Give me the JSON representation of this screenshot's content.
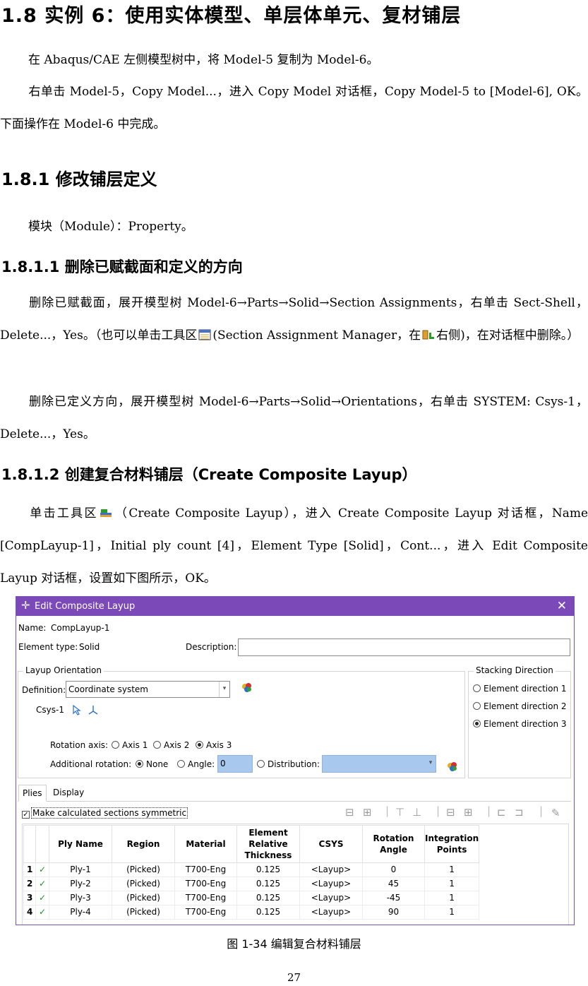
{
  "heading_1_8": "1.8 实例 6：使用实体模型、单层体单元、复材铺层",
  "p1": "在 Abaqus/CAE 左侧模型树中，将 Model-5 复制为 Model-6。",
  "p2": "右单击 Model-5，Copy Model...，进入 Copy Model 对话框，Copy Model-5 to [Model-6], OK。下面操作在 Model-6 中完成。",
  "heading_1_8_1": "1.8.1 修改铺层定义",
  "p3": "模块（Module）：Property。",
  "heading_1_8_1_1": "1.8.1.1 删除已赋截面和定义的方向",
  "p4a": "删除已赋截面，展开模型树 Model-6→Parts→Solid→Section Assignments，右单击 Sect-Shell，Delete...，Yes。（也可以单击工具区",
  "p4b": "(Section Assignment Manager，在",
  "p4c": "右侧)，在对话框中删除。）",
  "p5": "删除已定义方向，展开模型树 Model-6→Parts→Solid→Orientations，右单击 SYSTEM: Csys-1，Delete...，Yes。",
  "heading_1_8_1_2": "1.8.1.2 创建复合材料铺层（Create Composite Layup）",
  "p6a": "单击工具区",
  "p6b": "（Create Composite Layup），进入 Create Composite Layup 对话框，Name [CompLayup-1]，Initial ply count [4]，Element Type [Solid]，Cont...，进入 Edit Composite Layup 对话框，设置如下图所示，OK。",
  "dialog": {
    "title": "Edit Composite Layup",
    "name_label": "Name:",
    "name_value": "CompLayup-1",
    "element_type_label": "Element type:",
    "element_type_value": "Solid",
    "description_label": "Description:",
    "description_value": "",
    "layup_orientation_title": "Layup Orientation",
    "definition_label": "Definition:",
    "definition_value": "Coordinate system",
    "csys_value": "Csys-1",
    "rotation_axis_label": "Rotation axis:",
    "axis_options": [
      "Axis 1",
      "Axis 2",
      "Axis 3"
    ],
    "axis_selected": "Axis 3",
    "additional_rotation_label": "Additional rotation:",
    "none_label": "None",
    "angle_label": "Angle:",
    "angle_value": "0",
    "distribution_label": "Distribution:",
    "stacking_title": "Stacking Direction",
    "stacking_options": [
      "Element direction 1",
      "Element direction 2",
      "Element direction 3"
    ],
    "stacking_selected": "Element direction 3",
    "tabs": [
      "Plies",
      "Display"
    ],
    "active_tab": "Plies",
    "symmetric_label": "Make calculated sections symmetric",
    "columns": [
      "Ply Name",
      "Region",
      "Material",
      "Element Relative Thickness",
      "CSYS",
      "Rotation Angle",
      "Integration Points"
    ],
    "rows": [
      {
        "num": "1",
        "ply": "Ply-1",
        "region": "(Picked)",
        "material": "T700-Eng",
        "thickness": "0.125",
        "csys": "<Layup>",
        "angle": "0",
        "points": "1"
      },
      {
        "num": "2",
        "ply": "Ply-2",
        "region": "(Picked)",
        "material": "T700-Eng",
        "thickness": "0.125",
        "csys": "<Layup>",
        "angle": "45",
        "points": "1"
      },
      {
        "num": "3",
        "ply": "Ply-3",
        "region": "(Picked)",
        "material": "T700-Eng",
        "thickness": "0.125",
        "csys": "<Layup>",
        "angle": "-45",
        "points": "1"
      },
      {
        "num": "4",
        "ply": "Ply-4",
        "region": "(Picked)",
        "material": "T700-Eng",
        "thickness": "0.125",
        "csys": "<Layup>",
        "angle": "90",
        "points": "1"
      }
    ]
  },
  "caption": "图 1-34  编辑复合材料铺层",
  "page_number": "27",
  "colors": {
    "titlebar": "#7b4ab8",
    "field_highlight": "#a9c8ee",
    "check": "#1f8f1f"
  }
}
